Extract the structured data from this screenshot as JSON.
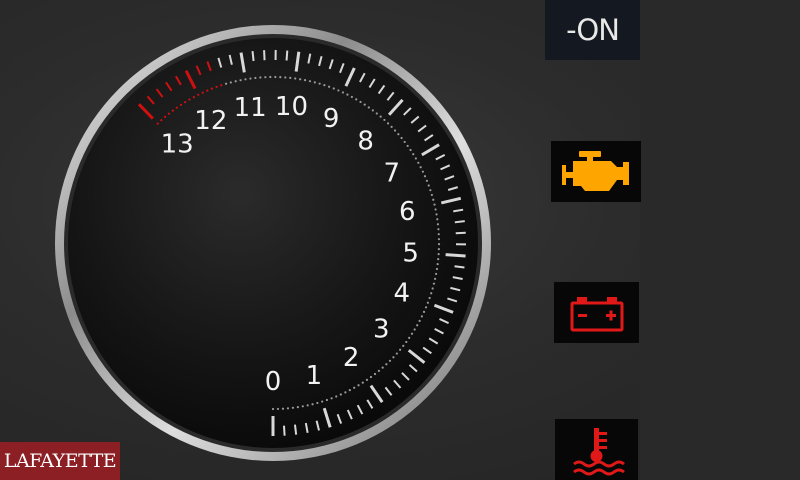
{
  "status": {
    "text": "-ON"
  },
  "gauge": {
    "scale_min": 0,
    "scale_max": 13,
    "labels": [
      "0",
      "1",
      "2",
      "3",
      "4",
      "5",
      "6",
      "7",
      "8",
      "9",
      "10",
      "11",
      "12",
      "13"
    ],
    "redline_start": 11.5,
    "needle_value": 0
  },
  "warnings": [
    {
      "icon": "check-engine-icon",
      "color": "#ffa500"
    },
    {
      "icon": "battery-icon",
      "color": "#e01818"
    },
    {
      "icon": "coolant-temperature-icon",
      "color": "#e01818"
    }
  ],
  "logo": {
    "text": "LAFAYETTE"
  }
}
